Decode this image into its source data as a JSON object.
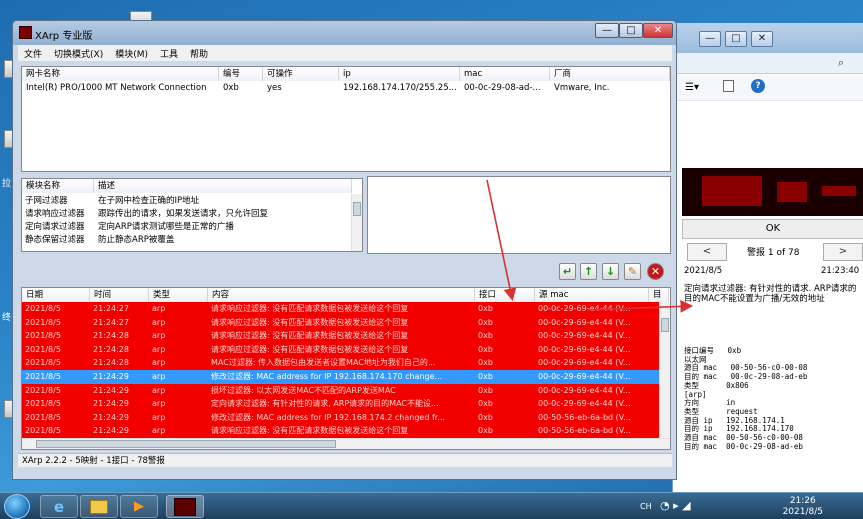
{
  "window": {
    "title": "XArp 专业版"
  },
  "menu": [
    "文件",
    "切换模式(X)",
    "模块(M)",
    "工具",
    "帮助"
  ],
  "adapters": {
    "columns": [
      "网卡名称",
      "编号",
      "可操作",
      "ip",
      "mac",
      "厂商"
    ],
    "rows": [
      [
        "Intel(R) PRO/1000 MT Network Connection",
        "0xb",
        "yes",
        "192.168.174.170/255.25...",
        "00-0c-29-08-ad-...",
        "Vmware, Inc."
      ]
    ]
  },
  "modules": {
    "columns": [
      "模块名称",
      "描述"
    ],
    "rows": [
      [
        "子网过滤器",
        "在子网中检查正确的IP地址"
      ],
      [
        "请求响应过滤器",
        "跟踪传出的请求，如果发送请求，只允许回复"
      ],
      [
        "定向请求过滤器",
        "定向ARP请求测试哪些是正常的广播"
      ],
      [
        "静态保留过滤器",
        "防止静态ARP被覆盖"
      ]
    ]
  },
  "log": {
    "columns": [
      "日期",
      "时间",
      "类型",
      "内容",
      "接口",
      "源 mac",
      "目"
    ],
    "rows": [
      [
        "2021/8/5",
        "21:24:27",
        "arp",
        "请求响应过滤器: 没有匹配请求数据包被发送给这个回复",
        "0xb",
        "00-0c-29-69-e4-44 (V...",
        "red"
      ],
      [
        "2021/8/5",
        "21:24:27",
        "arp",
        "请求响应过滤器: 没有匹配请求数据包被发送给这个回复",
        "0xb",
        "00-0c-29-69-e4-44 (V...",
        "red"
      ],
      [
        "2021/8/5",
        "21:24:28",
        "arp",
        "请求响应过滤器: 没有匹配请求数据包被发送给这个回复",
        "0xb",
        "00-0c-29-69-e4-44 (V...",
        "red"
      ],
      [
        "2021/8/5",
        "21:24:28",
        "arp",
        "请求响应过滤器: 没有匹配请求数据包被发送给这个回复",
        "0xb",
        "00-0c-29-69-e4-44 (V...",
        "red"
      ],
      [
        "2021/8/5",
        "21:24:28",
        "arp",
        "MAC过滤器: 传入数据包由发送者设置MAC地址为我们自己的...",
        "0xb",
        "00-0c-29-69-e4-44 (V...",
        "red"
      ],
      [
        "2021/8/5",
        "21:24:29",
        "arp",
        "修改过滤器: MAC address for IP 192.168.174.170 change...",
        "0xb",
        "00-0c-29-69-e4-44 (V...",
        "sel"
      ],
      [
        "2021/8/5",
        "21:24:29",
        "arp",
        "损坏过滤器: 以太网发送MAC不匹配的ARP发送MAC",
        "0xb",
        "00-0c-29-69-e4-44 (V...",
        "red"
      ],
      [
        "2021/8/5",
        "21:24:29",
        "arp",
        "定向请求过滤器: 有针对性的请求, ARP请求的目的MAC不能设...",
        "0xb",
        "00-0c-29-69-e4-44 (V...",
        "red"
      ],
      [
        "2021/8/5",
        "21:24:29",
        "arp",
        "修改过滤器: MAC address for IP 192.168.174.2 changed fr...",
        "0xb",
        "00-50-56-eb-6a-bd (V...",
        "red"
      ],
      [
        "2021/8/5",
        "21:24:29",
        "arp",
        "请求响应过滤器: 没有匹配请求数据包被发送给这个回复",
        "0xb",
        "00-50-56-eb-6a-bd (V...",
        "red"
      ]
    ]
  },
  "status": "XArp 2.2.2  -  5映射  -  1接口  -  78警报",
  "alert": {
    "ok": "OK",
    "prev": "<",
    "next": ">",
    "counter": "警报 1 of 78",
    "date": "2021/8/5",
    "time": "21:23:40",
    "message": "定向请求过滤器: 有针对性的请求. ARP请求的目的MAC不能设置为广播/无效的地址",
    "details": "接口编号   0xb\n以太网\n源自 mac   00-50-56-c0-00-08\n目的 mac   00-0c-29-08-ad-eb\n类型      0x806\n[arp]\n方向      in\n类型      request\n源自 ip   192.168.174.1\n目的 ip   192.168.174.170\n源自 mac  00-50-56-c0-00-08\n目的 mac  00-0c-29-08-ad-eb"
  },
  "taskbar": {
    "time": "21:26",
    "date": "2021/8/5",
    "ime": "CH"
  },
  "desktop": {
    "left_labels": [
      "拉",
      "终"
    ]
  },
  "colors": {
    "alert_row": "#f20000",
    "selected_row": "#3399ff",
    "arrow": "#d93030"
  }
}
